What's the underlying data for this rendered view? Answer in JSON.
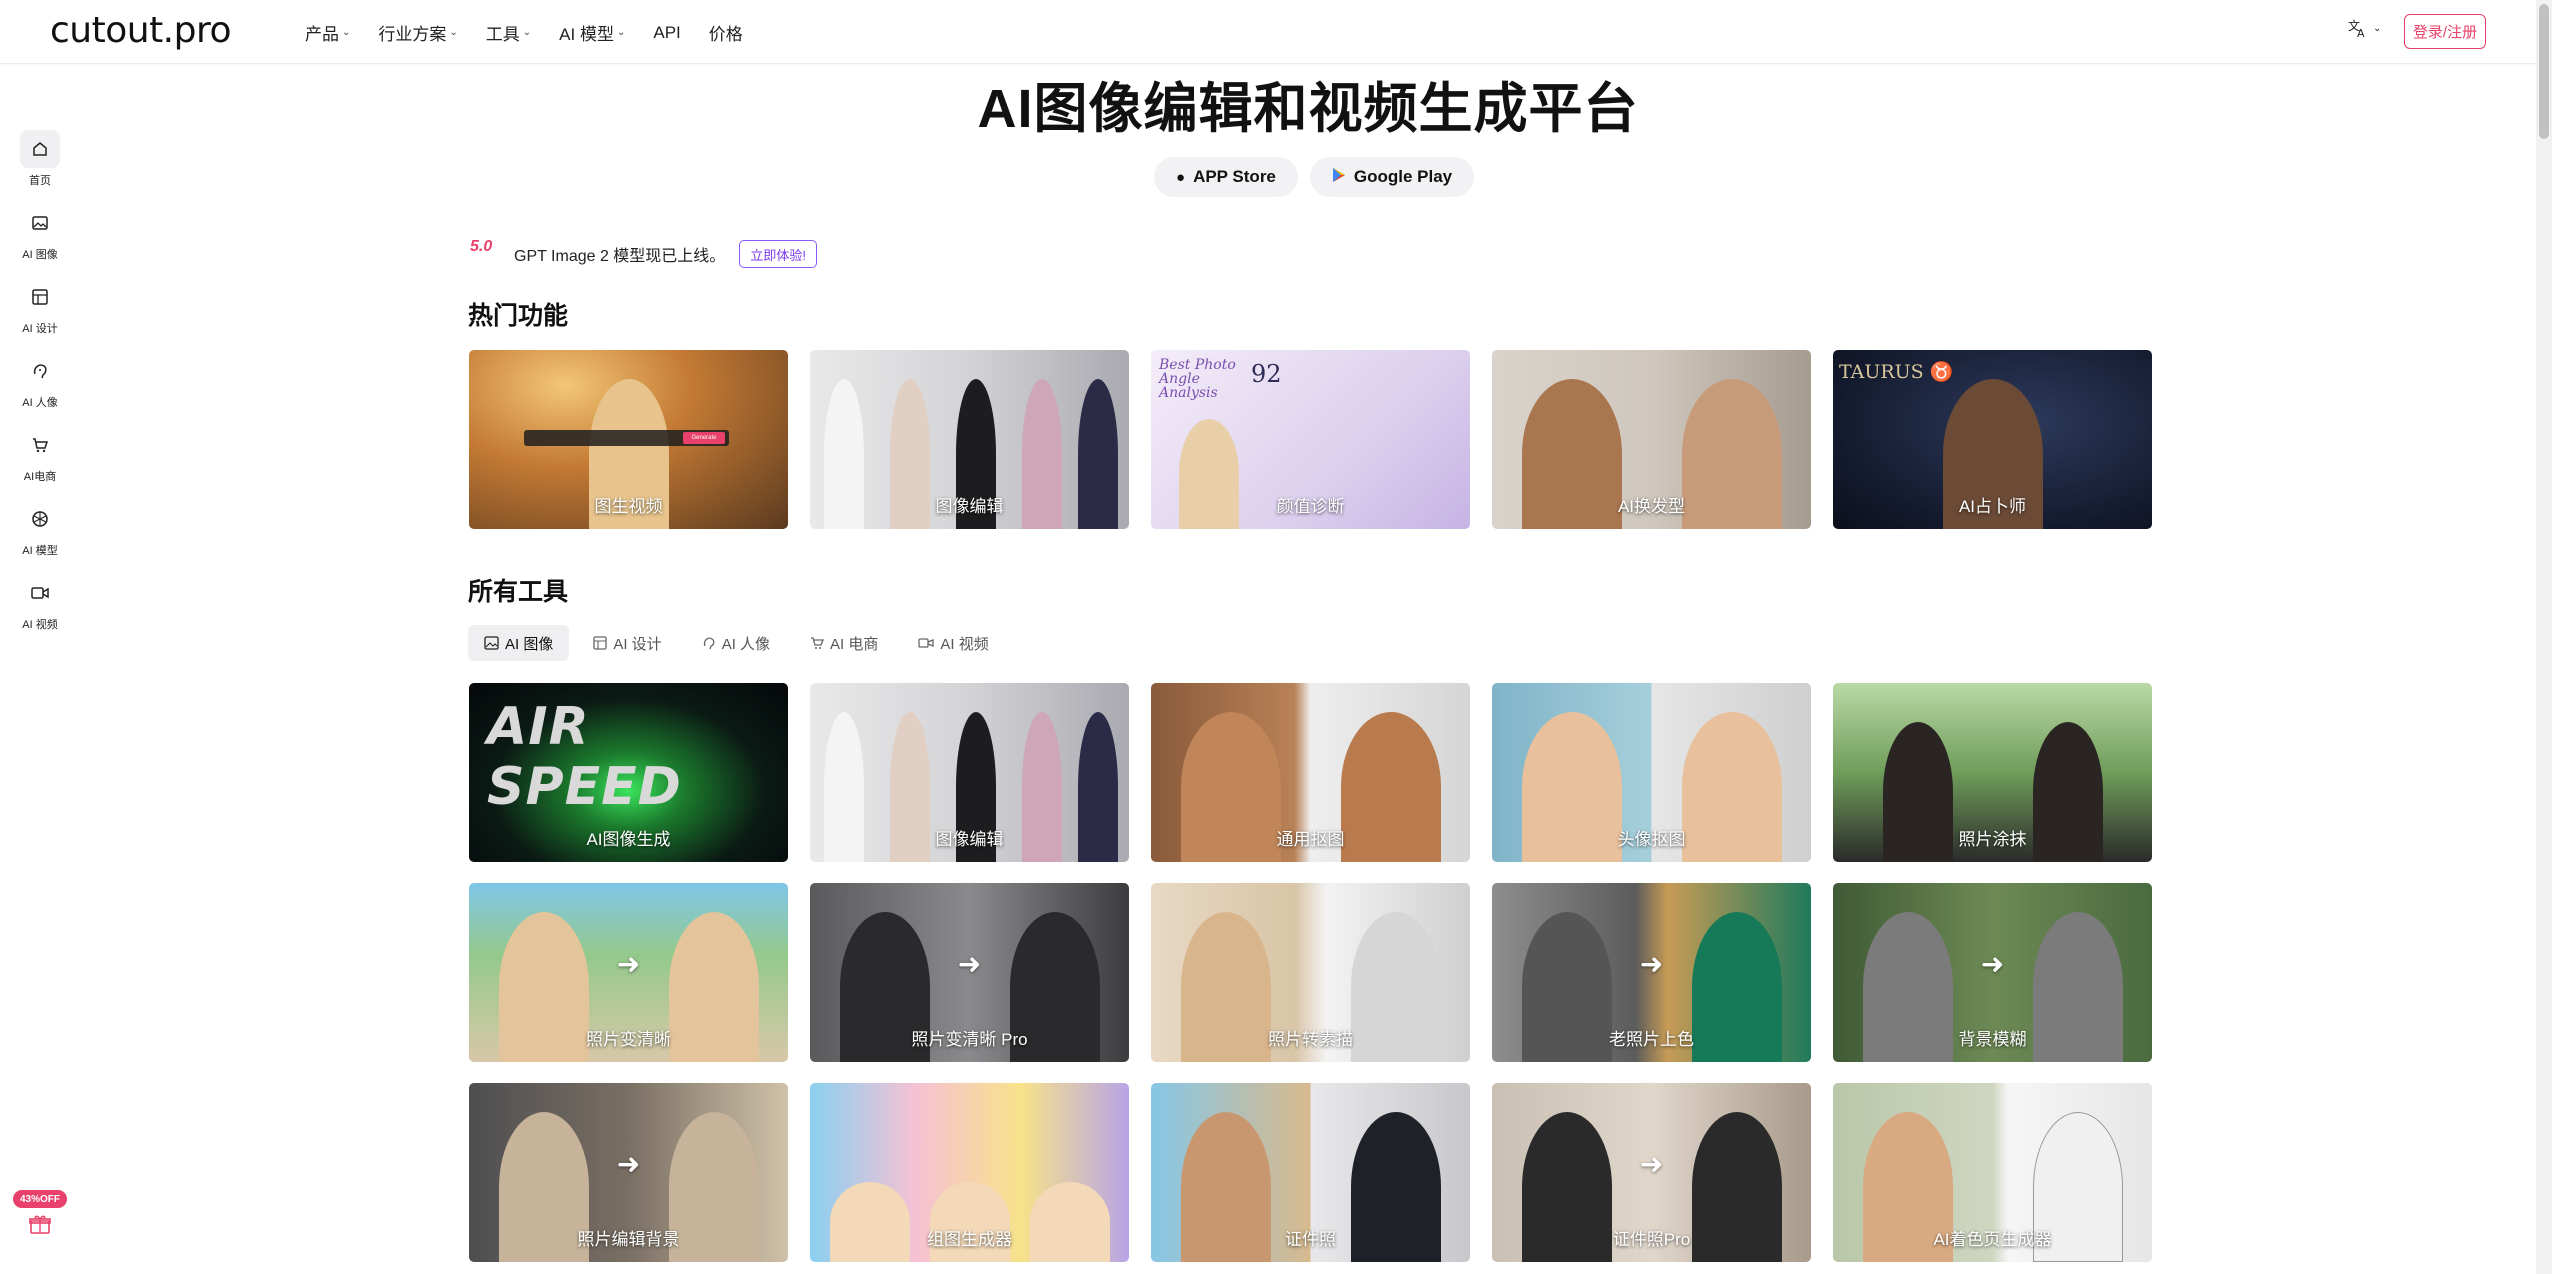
{
  "header": {
    "logo": "cutout.pro",
    "nav": [
      {
        "label": "产品",
        "has_menu": true
      },
      {
        "label": "行业方案",
        "has_menu": true
      },
      {
        "label": "工具",
        "has_menu": true
      },
      {
        "label": "AI 模型",
        "has_menu": true
      },
      {
        "label": "API",
        "has_menu": false
      },
      {
        "label": "价格",
        "has_menu": false
      }
    ],
    "language_icon": "translate-icon",
    "login_label": "登录/注册"
  },
  "rail": {
    "items": [
      {
        "label": "首页",
        "icon": "home-icon",
        "active": true
      },
      {
        "label": "AI 图像",
        "icon": "image-icon",
        "active": false
      },
      {
        "label": "AI 设计",
        "icon": "layout-icon",
        "active": false
      },
      {
        "label": "AI 人像",
        "icon": "face-icon",
        "active": false
      },
      {
        "label": "AI电商",
        "icon": "cart-icon",
        "active": false
      },
      {
        "label": "AI 模型",
        "icon": "model-icon",
        "active": false
      },
      {
        "label": "AI 视频",
        "icon": "video-icon",
        "active": false
      }
    ],
    "promo_badge": "43%OFF"
  },
  "hero": {
    "title": "AI图像编辑和视频生成平台",
    "app_store": "APP Store",
    "google_play": "Google Play"
  },
  "announcement": {
    "logo_text": "5.0",
    "text": "GPT Image 2 模型现已上线。",
    "cta": "立即体验!"
  },
  "hot": {
    "title": "热门功能",
    "cards": [
      {
        "label": "图生视频",
        "style": "img-warm",
        "generate_label": "Generate"
      },
      {
        "label": "图像编辑",
        "style": "img-people"
      },
      {
        "label": "颜值诊断",
        "style": "img-lilac",
        "overlay_title": "Best Photo Angle Analysis",
        "overlay_score": "92"
      },
      {
        "label": "AI换发型",
        "style": "img-hair"
      },
      {
        "label": "AI占卜师",
        "style": "img-astro",
        "overlay_title": "TAURUS ♉"
      }
    ]
  },
  "all_tools": {
    "title": "所有工具",
    "tabs": [
      {
        "label": "AI 图像",
        "icon": "image-icon",
        "active": true
      },
      {
        "label": "AI 设计",
        "icon": "layout-icon",
        "active": false
      },
      {
        "label": "AI 人像",
        "icon": "face-icon",
        "active": false
      },
      {
        "label": "AI 电商",
        "icon": "cart-icon",
        "active": false
      },
      {
        "label": "AI 视频",
        "icon": "video-icon",
        "active": false
      }
    ],
    "rows": [
      [
        {
          "label": "AI图像生成",
          "style": "img-shoe",
          "overlay_title": "AIR SPEED"
        },
        {
          "label": "图像编辑",
          "style": "img-people"
        },
        {
          "label": "通用抠图",
          "style": "img-curly"
        },
        {
          "label": "头像抠图",
          "style": "img-kid"
        },
        {
          "label": "照片涂抹",
          "style": "img-park"
        }
      ],
      [
        {
          "label": "照片变清晰",
          "style": "img-palm"
        },
        {
          "label": "照片变清晰 Pro",
          "style": "img-bw"
        },
        {
          "label": "照片转素描",
          "style": "img-sketch"
        },
        {
          "label": "老照片上色",
          "style": "img-old"
        },
        {
          "label": "背景模糊",
          "style": "img-forest"
        }
      ],
      [
        {
          "label": "照片编辑背景",
          "style": "img-paris"
        },
        {
          "label": "组图生成器",
          "style": "img-cats"
        },
        {
          "label": "证件照",
          "style": "img-beach"
        },
        {
          "label": "证件照Pro",
          "style": "img-idpro"
        },
        {
          "label": "AI着色页生成器",
          "style": "img-coloring"
        }
      ]
    ]
  }
}
